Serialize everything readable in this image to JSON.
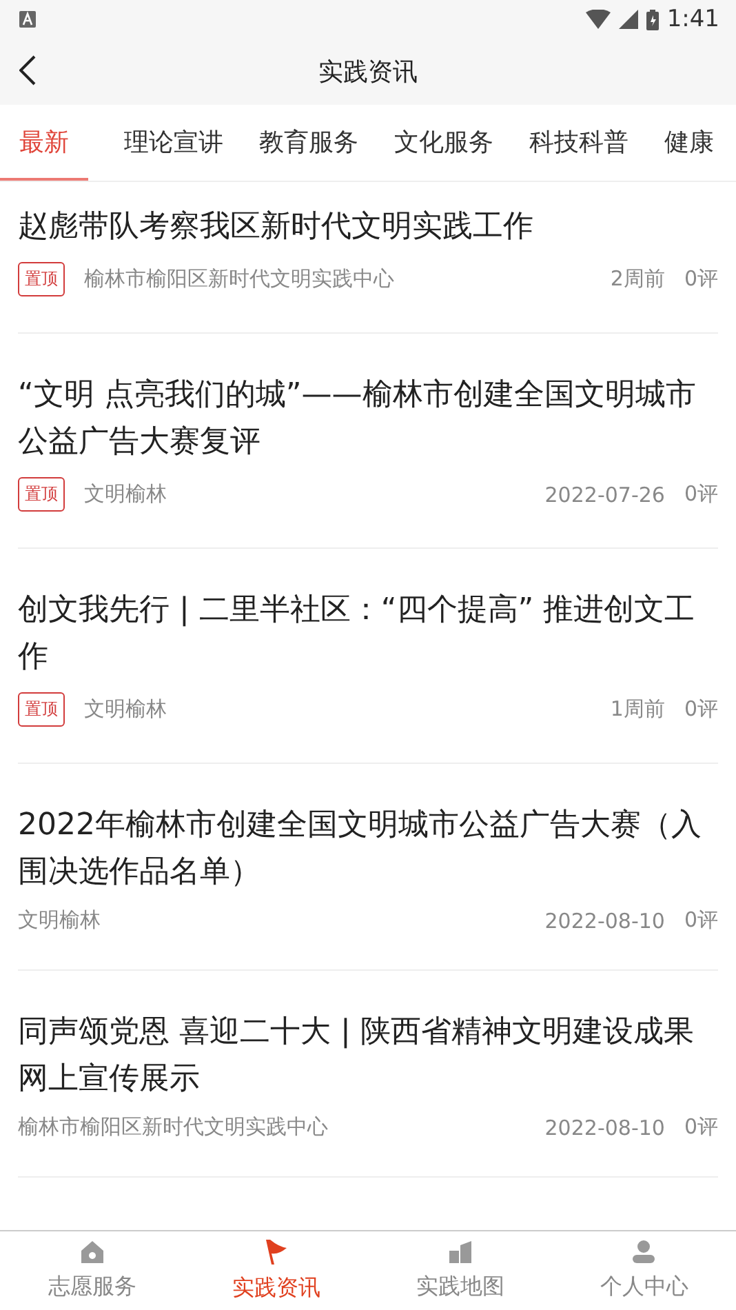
{
  "status_bar": {
    "time": "1:41"
  },
  "header": {
    "title": "实践资讯"
  },
  "tabs": [
    {
      "label": "最新",
      "selected": true
    },
    {
      "label": "理论宣讲",
      "selected": false
    },
    {
      "label": "教育服务",
      "selected": false
    },
    {
      "label": "文化服务",
      "selected": false
    },
    {
      "label": "科技科普",
      "selected": false
    },
    {
      "label": "健康",
      "selected": false
    }
  ],
  "articles": [
    {
      "title": "赵彪带队考察我区新时代文明实践工作",
      "badge": "置顶",
      "source": "榆林市榆阳区新时代文明实践中心",
      "date": "2周前",
      "comments": "0评"
    },
    {
      "title": "“文明 点亮我们的城”——榆林市创建全国文明城市公益广告大赛复评",
      "badge": "置顶",
      "source": "文明榆林",
      "date": "2022-07-26",
      "comments": "0评"
    },
    {
      "title": "创文我先行 | 二里半社区：“四个提高” 推进创文工作",
      "badge": "置顶",
      "source": "文明榆林",
      "date": "1周前",
      "comments": "0评"
    },
    {
      "title": "2022年榆林市创建全国文明城市公益广告大赛（入围决选作品名单）",
      "source": "文明榆林",
      "date": "2022-08-10",
      "comments": "0评"
    },
    {
      "title": "同声颂党恩 喜迎二十大 | 陕西省精神文明建设成果网上宣传展示",
      "source": "榆林市榆阳区新时代文明实践中心",
      "date": "2022-08-10",
      "comments": "0评"
    }
  ],
  "bottom_nav": [
    {
      "kind": "home",
      "label": "志愿服务",
      "selected": false
    },
    {
      "kind": "flag",
      "label": "实践资讯",
      "selected": true
    },
    {
      "kind": "building",
      "label": "实践地图",
      "selected": false
    },
    {
      "kind": "person",
      "label": "个人中心",
      "selected": false
    }
  ]
}
